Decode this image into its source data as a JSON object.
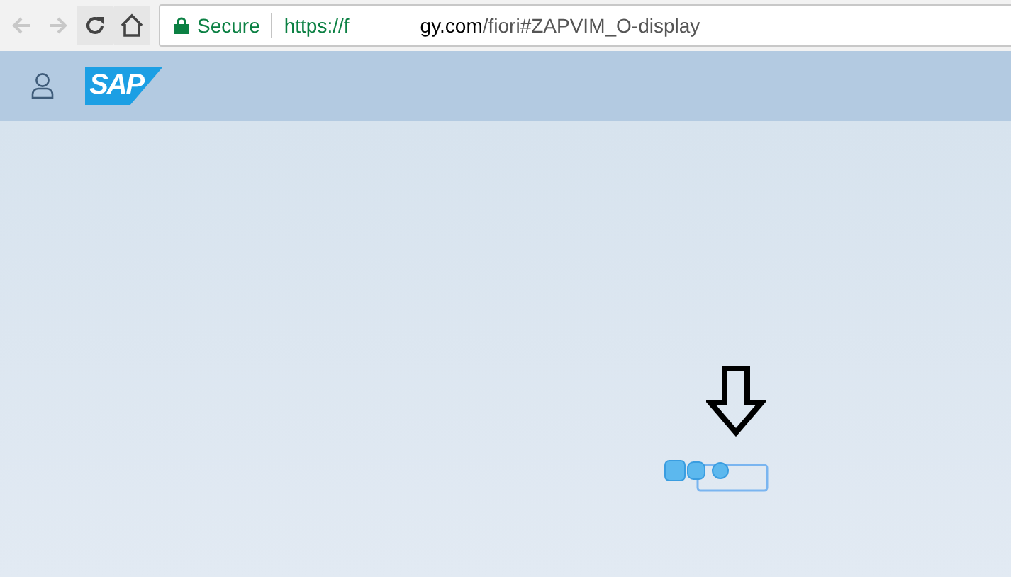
{
  "browser": {
    "security_label": "Secure",
    "url_start": "https://f",
    "url_host_end": "gy.com",
    "url_path": "/fiori#ZAPVIM_O-display"
  },
  "shell": {
    "logo": "SAP"
  }
}
